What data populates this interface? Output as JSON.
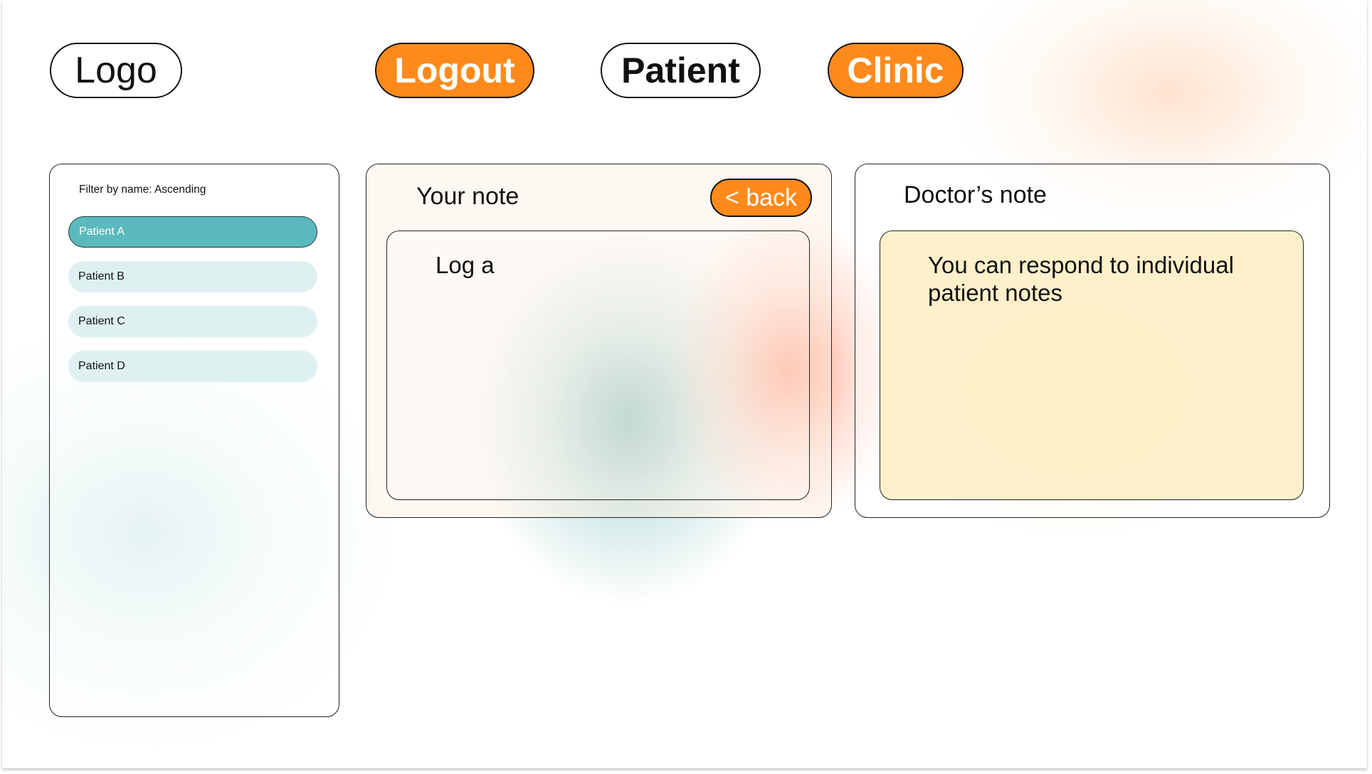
{
  "header": {
    "logo_label": "Logo",
    "logout_label": "Logout",
    "patient_label": "Patient",
    "clinic_label": "Clinic"
  },
  "sidebar": {
    "filter_label": "Filter by name: Ascending",
    "patients": [
      {
        "label": "Patient A",
        "selected": true
      },
      {
        "label": "Patient B",
        "selected": false
      },
      {
        "label": "Patient C",
        "selected": false
      },
      {
        "label": "Patient D",
        "selected": false
      }
    ]
  },
  "note_panel": {
    "title": "Your note",
    "back_label": "< back",
    "content": "Log a"
  },
  "doctor_panel": {
    "title": "Doctor’s note",
    "content": "You can respond to individual patient notes"
  },
  "colors": {
    "accent_orange": "#ff8a1c",
    "selected_teal": "#5bb9bd",
    "item_teal_light": "#dff0f1",
    "doctor_box_yellow": "#ffedc3"
  }
}
